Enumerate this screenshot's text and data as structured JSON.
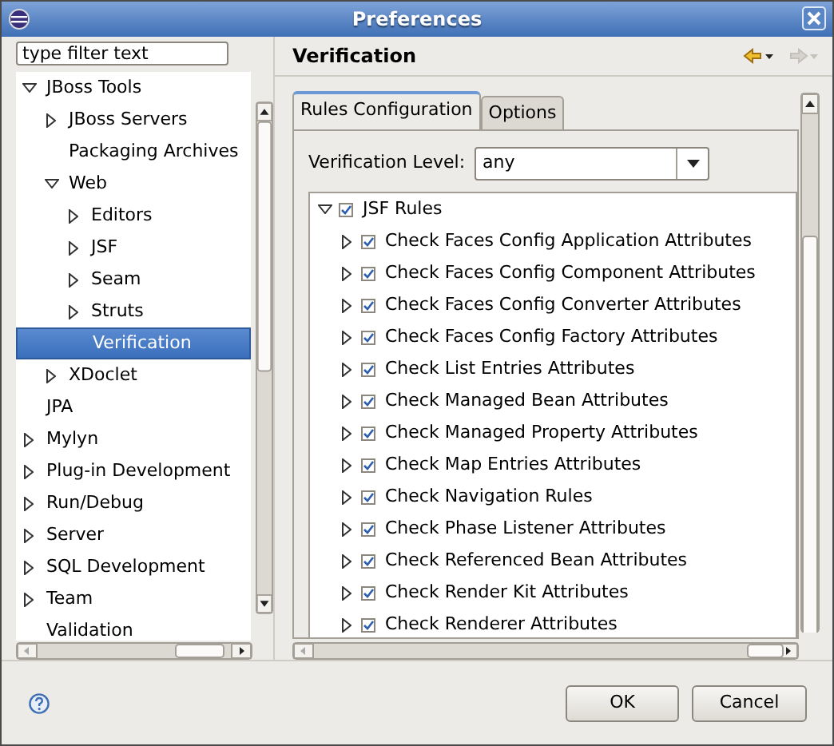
{
  "window": {
    "title": "Preferences"
  },
  "sidebar": {
    "filter": {
      "value": "type filter text"
    },
    "tree": [
      {
        "label": "JBoss Tools",
        "selected": false,
        "expanded": true,
        "children": [
          {
            "label": "JBoss Servers",
            "selected": false,
            "expanded": false
          },
          {
            "label": "Packaging Archives",
            "selected": false
          },
          {
            "label": "Web",
            "selected": false,
            "expanded": true,
            "children": [
              {
                "label": "Editors",
                "selected": false,
                "expanded": false
              },
              {
                "label": "JSF",
                "selected": false,
                "expanded": false
              },
              {
                "label": "Seam",
                "selected": false,
                "expanded": false
              },
              {
                "label": "Struts",
                "selected": false,
                "expanded": false
              },
              {
                "label": "Verification",
                "selected": true
              }
            ]
          },
          {
            "label": "XDoclet",
            "selected": false,
            "expanded": false
          }
        ]
      },
      {
        "label": "JPA",
        "selected": false
      },
      {
        "label": "Mylyn",
        "selected": false,
        "expanded": false
      },
      {
        "label": "Plug-in Development",
        "selected": false,
        "expanded": false
      },
      {
        "label": "Run/Debug",
        "selected": false,
        "expanded": false
      },
      {
        "label": "Server",
        "selected": false,
        "expanded": false
      },
      {
        "label": "SQL Development",
        "selected": false,
        "expanded": false
      },
      {
        "label": "Team",
        "selected": false,
        "expanded": false
      },
      {
        "label": "Validation",
        "selected": false
      }
    ]
  },
  "page": {
    "title": "Verification",
    "back": {
      "disabled": false
    },
    "forward": {
      "disabled": true
    },
    "tabs": [
      {
        "label": "Rules Configuration",
        "selected": true
      },
      {
        "label": "Options",
        "selected": false
      }
    ],
    "verification_level": {
      "label": "Verification Level:",
      "value": "any"
    },
    "rules": [
      {
        "label": "JSF Rules",
        "checked": true,
        "expanded": true,
        "children": [
          {
            "label": "Check Faces Config Application Attributes",
            "checked": true,
            "expanded": false
          },
          {
            "label": "Check Faces Config Component Attributes",
            "checked": true,
            "expanded": false
          },
          {
            "label": "Check Faces Config Converter Attributes",
            "checked": true,
            "expanded": false
          },
          {
            "label": "Check Faces Config Factory Attributes",
            "checked": true,
            "expanded": false
          },
          {
            "label": "Check List Entries Attributes",
            "checked": true,
            "expanded": false
          },
          {
            "label": "Check Managed Bean Attributes",
            "checked": true,
            "expanded": false
          },
          {
            "label": "Check Managed Property Attributes",
            "checked": true,
            "expanded": false
          },
          {
            "label": "Check Map Entries Attributes",
            "checked": true,
            "expanded": false
          },
          {
            "label": "Check Navigation Rules",
            "checked": true,
            "expanded": false
          },
          {
            "label": "Check Phase Listener Attributes",
            "checked": true,
            "expanded": false
          },
          {
            "label": "Check Referenced Bean Attributes",
            "checked": true,
            "expanded": false
          },
          {
            "label": "Check Render Kit Attributes",
            "checked": true,
            "expanded": false
          },
          {
            "label": "Check Renderer Attributes",
            "checked": true,
            "expanded": false
          }
        ]
      }
    ]
  },
  "buttons": [
    {
      "label": "OK"
    },
    {
      "label": "Cancel"
    }
  ]
}
